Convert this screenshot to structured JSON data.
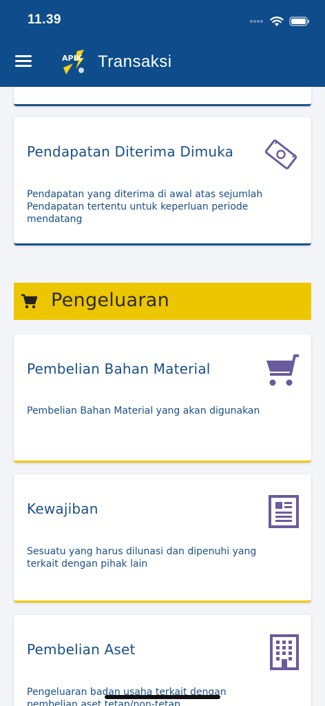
{
  "status": {
    "time": "11.39"
  },
  "header": {
    "title": "Transaksi",
    "logo_text": "APIK"
  },
  "section": {
    "title": "Pengeluaran"
  },
  "cards": [
    {
      "title": "Pendapatan Diterima Dimuka",
      "description": "Pendapatan yang diterima di awal atas sejumlah Pendapatan tertentu untuk keperluan periode mendatang",
      "icon": "money-bill-icon"
    },
    {
      "title": "Pembelian Bahan Material",
      "description": "Pembelian Bahan Material yang akan digunakan",
      "icon": "shopping-cart-icon"
    },
    {
      "title": "Kewajiban",
      "description": "Sesuatu yang harus dilunasi dan dipenuhi yang terkait dengan pihak lain",
      "icon": "document-icon"
    },
    {
      "title": "Pembelian Aset",
      "description": "Pengeluaran badan usaha terkait dengan pembelian aset tetap/non-tetap",
      "icon": "building-icon"
    }
  ],
  "colors": {
    "header": "#0e4c8b",
    "primary_text": "#1a4f86",
    "section_bg": "#ecc600",
    "icon_purple": "#6a5b9c"
  }
}
